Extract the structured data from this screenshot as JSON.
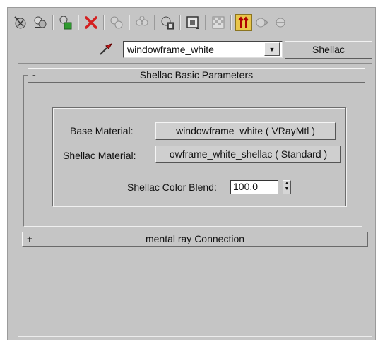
{
  "toolbar": {
    "icons": [
      "get-material-icon",
      "put-to-scene-icon",
      "assign-material-icon",
      "delete-icon",
      "make-unique-icon",
      "put-to-library-icon",
      "material-id-icon",
      "show-map-icon",
      "show-background-icon",
      "go-to-parent-icon",
      "go-forward-icon",
      "go-sibling-icon"
    ],
    "active_color": "#e9c64a"
  },
  "material": {
    "name": "windowframe_white",
    "type_button": "Shellac"
  },
  "rollout_shellac": {
    "sign": "-",
    "title": "Shellac Basic Parameters",
    "base_label": "Base Material:",
    "base_value": "windowframe_white  ( VRayMtl )",
    "shellac_label": "Shellac Material:",
    "shellac_value": "owframe_white_shellac  ( Standard )",
    "blend_label": "Shellac Color Blend:",
    "blend_value": "100.0"
  },
  "rollout_mentalray": {
    "sign": "+",
    "title": "mental ray Connection"
  }
}
